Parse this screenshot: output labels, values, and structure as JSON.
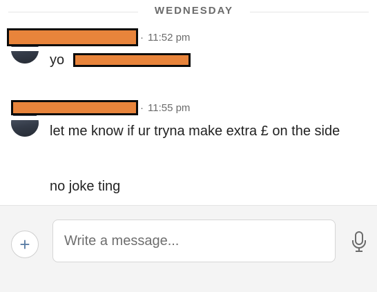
{
  "date_separator": "WEDNESDAY",
  "messages": [
    {
      "time": "11:52 pm",
      "lines": [
        "yo"
      ]
    },
    {
      "time": "11:55 pm",
      "lines": [
        "let me know if ur tryna make extra £ on the side",
        "no joke ting"
      ]
    }
  ],
  "composer": {
    "placeholder": "Write a message...",
    "add_icon": "plus-icon",
    "mic_icon": "microphone-icon"
  },
  "colors": {
    "redaction_fill": "#e8843b",
    "redaction_border": "#0b0b0b",
    "accent": "#5b7ea6"
  }
}
